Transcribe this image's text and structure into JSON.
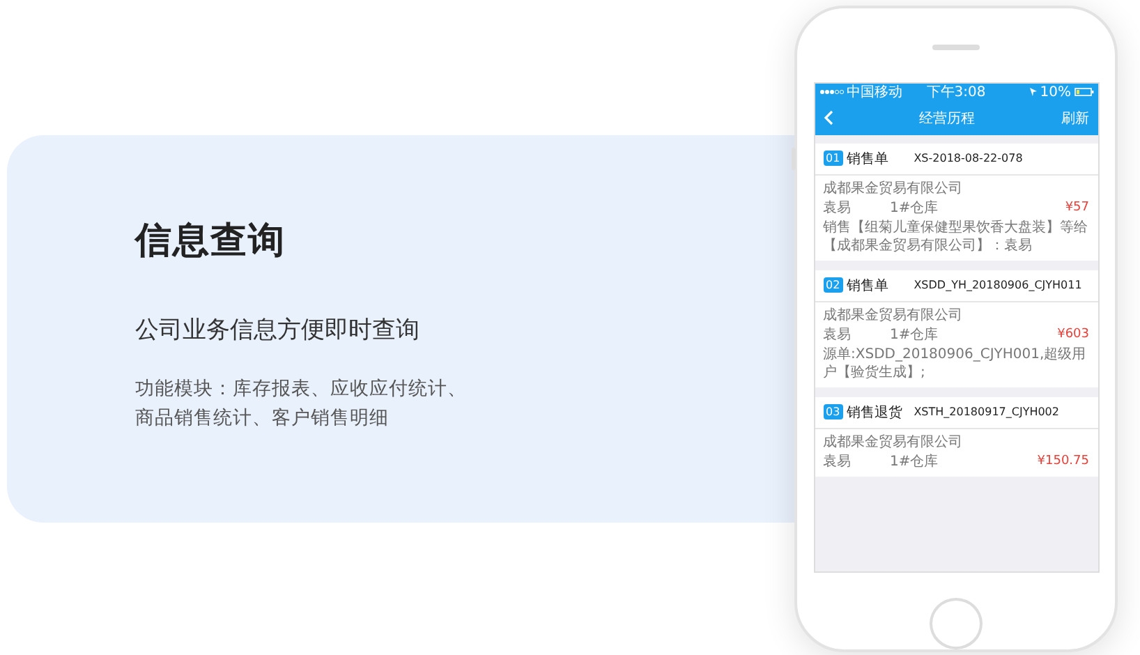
{
  "feature": {
    "title": "信息查询",
    "subtitle": "公司业务信息方便即时查询",
    "description_lines": [
      "功能模块：库存报表、应收应付统计、",
      "商品销售统计、客户销售明细"
    ]
  },
  "phone": {
    "status_bar": {
      "carrier": "中国移动",
      "time": "下午3:08",
      "battery": "10%"
    },
    "nav": {
      "title": "经营历程",
      "action": "刷新"
    },
    "records": [
      {
        "index": "01",
        "type": "销售单",
        "number": "XS-2018-08-22-078",
        "company": "成都果金贸易有限公司",
        "person": "袁易",
        "warehouse": "1#仓库",
        "amount": "¥57",
        "note": "销售【组菊儿童保健型果饮香大盘装】等给【成都果金贸易有限公司】：袁易"
      },
      {
        "index": "02",
        "type": "销售单",
        "number": "XSDD_YH_20180906_CJYH011",
        "company": "成都果金贸易有限公司",
        "person": "袁易",
        "warehouse": "1#仓库",
        "amount": "¥603",
        "note": "源单:XSDD_20180906_CJYH001,超级用户【验货生成】;"
      },
      {
        "index": "03",
        "type": "销售退货",
        "number": "XSTH_20180917_CJYH002",
        "company": "成都果金贸易有限公司",
        "person": "袁易",
        "warehouse": "1#仓库",
        "amount": "¥150.75"
      }
    ]
  }
}
